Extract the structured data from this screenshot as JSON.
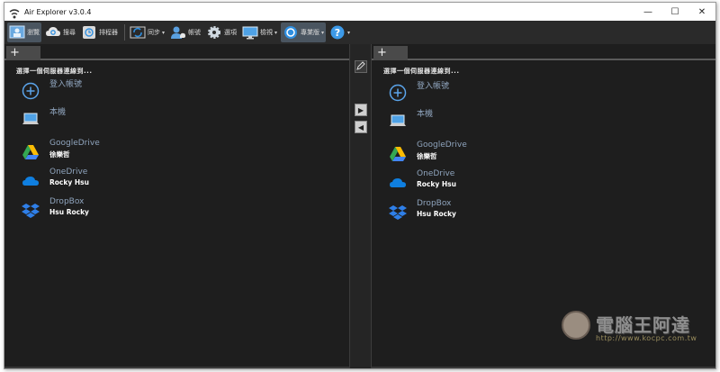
{
  "window": {
    "title": "Air Explorer v3.0.4"
  },
  "window_controls": {
    "minimize": "—",
    "maximize": "☐",
    "close": "✕"
  },
  "toolbar": {
    "items": [
      {
        "label": "瀏覽",
        "icon": "browse-icon"
      },
      {
        "label": "搜尋",
        "icon": "cloud-search-icon"
      },
      {
        "label": "排程器",
        "icon": "scheduler-icon"
      },
      {
        "label": "同步",
        "icon": "sync-icon"
      },
      {
        "label": "帳號",
        "icon": "accounts-icon"
      },
      {
        "label": "選項",
        "icon": "gear-icon"
      },
      {
        "label": "檢視",
        "icon": "monitor-icon"
      },
      {
        "label": "專業版",
        "icon": "pro-icon"
      },
      {
        "label": "",
        "icon": "help-icon"
      }
    ],
    "caret": "▾"
  },
  "panes": {
    "left": {
      "tab_add": "+",
      "title": "選擇一個伺服器連線到...",
      "entries": [
        {
          "name": "登入帳號",
          "sub": "",
          "icon": "add-account-icon"
        },
        {
          "name": "本機",
          "sub": "",
          "icon": "computer-icon"
        },
        {
          "name": "GoogleDrive",
          "sub": "徐樂哲",
          "icon": "google-drive-icon"
        },
        {
          "name": "OneDrive",
          "sub": "Rocky Hsu",
          "icon": "onedrive-icon"
        },
        {
          "name": "DropBox",
          "sub": "Hsu Rocky",
          "icon": "dropbox-icon"
        }
      ]
    },
    "right": {
      "tab_add": "+",
      "title": "選擇一個伺服器連線到...",
      "entries": [
        {
          "name": "登入帳號",
          "sub": "",
          "icon": "add-account-icon"
        },
        {
          "name": "本機",
          "sub": "",
          "icon": "computer-icon"
        },
        {
          "name": "GoogleDrive",
          "sub": "徐樂哲",
          "icon": "google-drive-icon"
        },
        {
          "name": "OneDrive",
          "sub": "Rocky Hsu",
          "icon": "onedrive-icon"
        },
        {
          "name": "DropBox",
          "sub": "Hsu Rocky",
          "icon": "dropbox-icon"
        }
      ]
    }
  },
  "middle": {
    "copy_right": "▶",
    "copy_left": "◀"
  },
  "watermark": {
    "title": "電腦王阿達",
    "url": "http://www.kocpc.com.tw"
  },
  "colors": {
    "background": "#1e1e1e",
    "entry_name": "#8fa4bd",
    "accent": "#2f8fe0"
  }
}
